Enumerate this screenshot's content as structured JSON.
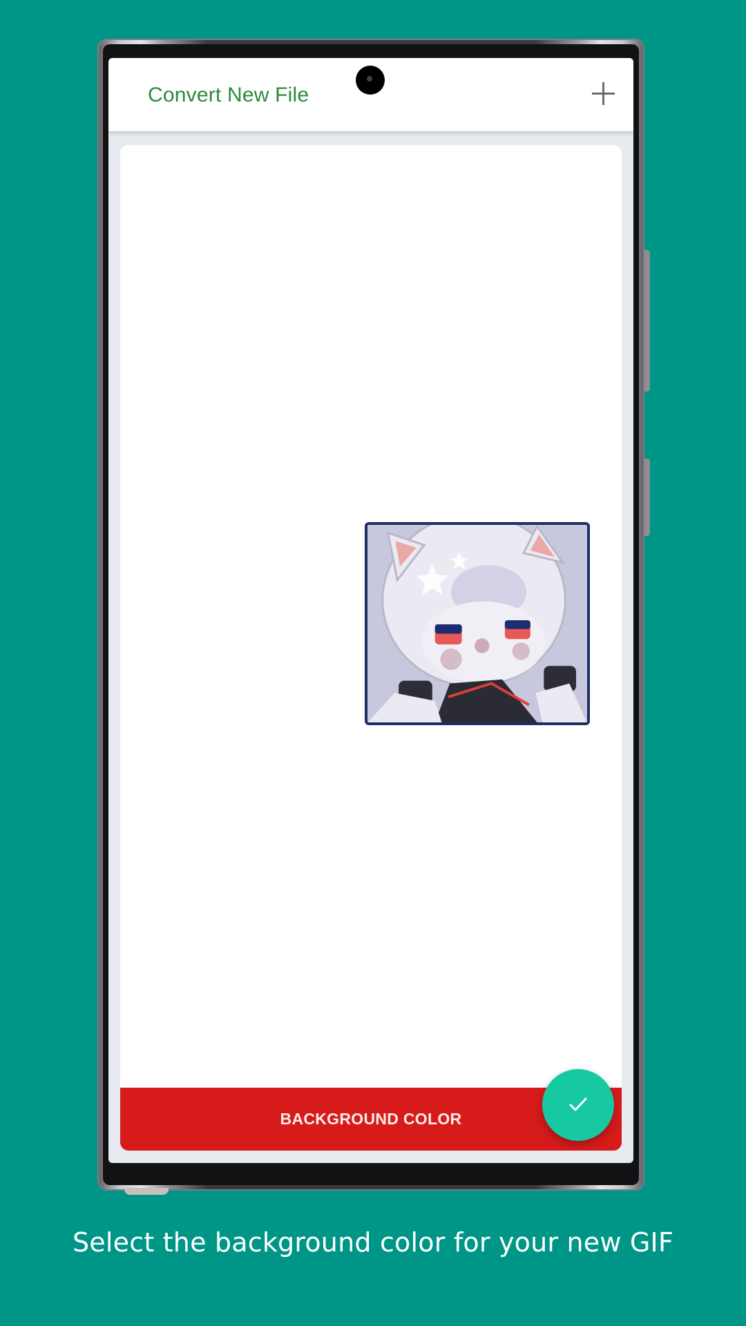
{
  "app_bar": {
    "title": "Convert New File",
    "add_icon": "plus-icon"
  },
  "preview": {
    "image_description": "anime cat-eared character GIF"
  },
  "actions": {
    "background_color_label": "BACKGROUND COLOR",
    "confirm_icon": "check-icon"
  },
  "caption": {
    "text": "Select the background color for your new GIF"
  },
  "colors": {
    "page_background": "#009687",
    "accent_red": "#d71b1b",
    "fab_teal": "#17c9a2",
    "title_green": "#2a8a3a"
  }
}
